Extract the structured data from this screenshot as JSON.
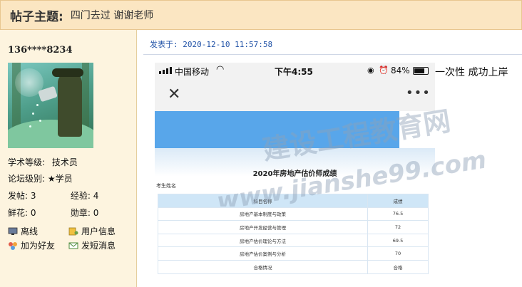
{
  "topic": {
    "label": "帖子主题:",
    "title": "四门去过 谢谢老师"
  },
  "user": {
    "name": "136****8234",
    "rows": [
      {
        "a_label": "学术等级:",
        "a_value": "技术员"
      },
      {
        "a_label": "论坛级别:",
        "a_value": "★学员"
      }
    ],
    "stats": [
      {
        "l1": "发帖:",
        "v1": "3",
        "l2": "经验:",
        "v2": "4"
      },
      {
        "l1": "鲜花:",
        "v1": "0",
        "l2": "勋章:",
        "v2": "0"
      }
    ],
    "links": [
      {
        "label": "离线",
        "icon": "monitor-icon"
      },
      {
        "label": "用户信息",
        "icon": "user-info-icon"
      },
      {
        "label": "加为好友",
        "icon": "add-friend-icon"
      },
      {
        "label": "发短消息",
        "icon": "message-icon"
      }
    ]
  },
  "post": {
    "time_label": "发表于:",
    "time_value": "2020-12-10 11:57:58",
    "text": "一次性 成功上岸"
  },
  "screenshot": {
    "carrier": "中国移动",
    "time": "下午4:55",
    "battery_pct": "84%",
    "title": "2020年房地产估价师成绩",
    "examinee_label": "考生姓名",
    "table_headers": [
      "科目名称",
      "成绩"
    ],
    "rows": [
      {
        "subject": "房地产基本制度与政策",
        "score": "76.5"
      },
      {
        "subject": "房地产开发经营与管理",
        "score": "72"
      },
      {
        "subject": "房地产估价理论与方法",
        "score": "69.5"
      },
      {
        "subject": "房地产估价案例与分析",
        "score": "70"
      },
      {
        "subject": "合格情况",
        "score": "合格"
      }
    ]
  },
  "watermark": {
    "line1": "建设工程教育网",
    "line2": "www.jianshe99.com"
  },
  "colors": {
    "topic_bg": "#fbe6c2",
    "left_bg": "#fdf4df",
    "link_blue": "#2354a8",
    "banner_blue": "#58a6ea"
  }
}
